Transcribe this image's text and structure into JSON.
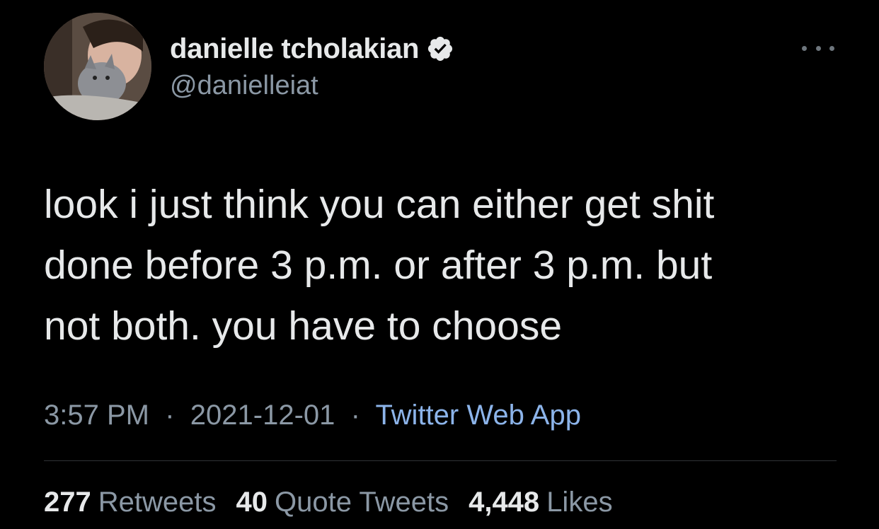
{
  "author": {
    "display_name": "danielle tcholakian",
    "handle": "@danielleiat",
    "verified": true
  },
  "tweet": {
    "text": "look i just think you can either get shit\ndone before 3 p.m. or after 3 p.m. but\nnot both. you have to choose",
    "time": "3:57 PM",
    "date": "2021-12-01",
    "separator": "·",
    "source": "Twitter Web App"
  },
  "stats": {
    "retweets_count": "277",
    "retweets_label": "Retweets",
    "quotes_count": "40",
    "quotes_label": "Quote Tweets",
    "likes_count": "4,448",
    "likes_label": "Likes"
  },
  "icons": {
    "verified": "verified-badge-icon",
    "more": "more-options-icon"
  },
  "colors": {
    "background": "#000000",
    "primary_text": "#e7e9ea",
    "secondary_text": "#8b98a5",
    "link": "#8cb4ea",
    "divider": "#2f3336"
  }
}
